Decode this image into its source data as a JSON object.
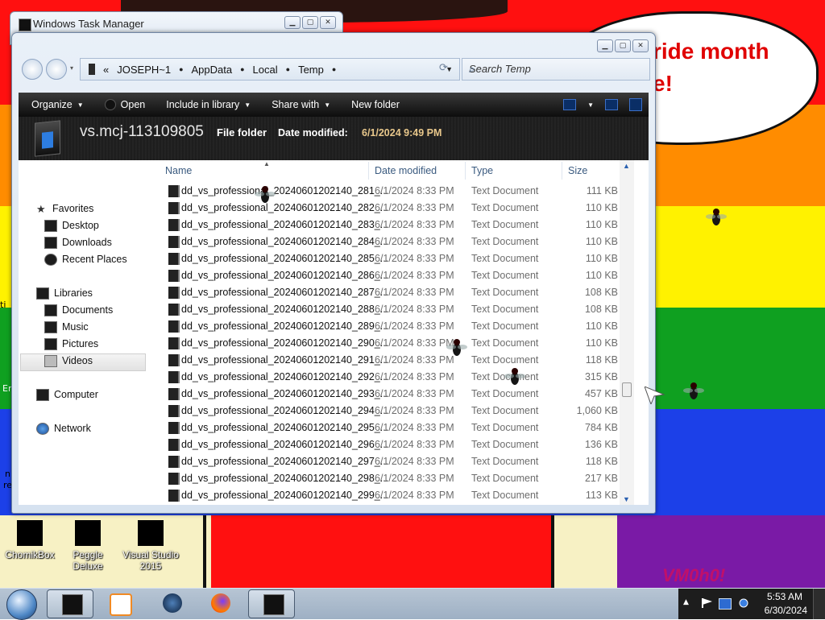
{
  "colors": {
    "red": "#ff1010",
    "orange": "#ff8c00",
    "yellow": "#fff200",
    "green": "#0fa020",
    "blue": "#1c40e8",
    "purple": "#7a1aa6",
    "toolbar_bg": "#1a1a1a",
    "accent_text": "#e8c78b"
  },
  "wallpaper": {
    "bubble_text": "ride month\ne!",
    "watermark": "VM0h0!",
    "edge_text_1": "ti",
    "edge_text_2": "Er",
    "edge_text_3": "n",
    "edge_text_4": "re"
  },
  "desktop_icons": [
    {
      "label": "ChomikBox"
    },
    {
      "label": "Peggle Deluxe"
    },
    {
      "label": "Visual Studio 2015"
    }
  ],
  "task_manager": {
    "title": "Windows Task Manager"
  },
  "explorer": {
    "address": {
      "overflow": "«",
      "crumbs": [
        "JOSEPH~1",
        "AppData",
        "Local",
        "Temp"
      ]
    },
    "search_placeholder": "Search Temp",
    "toolbar": {
      "organize": "Organize",
      "open": "Open",
      "include_in_library": "Include in library",
      "share_with": "Share with",
      "new_folder": "New folder"
    },
    "details": {
      "name": "vs.mcj-113109805",
      "type": "File folder",
      "modified_label": "Date modified:",
      "modified_value": "6/1/2024 9:49 PM"
    },
    "nav": {
      "favorites": "Favorites",
      "desktop": "Desktop",
      "downloads": "Downloads",
      "recent_places": "Recent Places",
      "libraries": "Libraries",
      "documents": "Documents",
      "music": "Music",
      "pictures": "Pictures",
      "videos": "Videos",
      "computer": "Computer",
      "network": "Network"
    },
    "columns": {
      "name": "Name",
      "date_modified": "Date modified",
      "type": "Type",
      "size": "Size"
    },
    "files": [
      {
        "name": "dd_vs_professional_20240601202140_281_...",
        "date": "6/1/2024 8:33 PM",
        "type": "Text Document",
        "size": "111 KB"
      },
      {
        "name": "dd_vs_professional_20240601202140_282_...",
        "date": "6/1/2024 8:33 PM",
        "type": "Text Document",
        "size": "110 KB"
      },
      {
        "name": "dd_vs_professional_20240601202140_283_...",
        "date": "6/1/2024 8:33 PM",
        "type": "Text Document",
        "size": "110 KB"
      },
      {
        "name": "dd_vs_professional_20240601202140_284_...",
        "date": "6/1/2024 8:33 PM",
        "type": "Text Document",
        "size": "110 KB"
      },
      {
        "name": "dd_vs_professional_20240601202140_285_...",
        "date": "6/1/2024 8:33 PM",
        "type": "Text Document",
        "size": "110 KB"
      },
      {
        "name": "dd_vs_professional_20240601202140_286_...",
        "date": "6/1/2024 8:33 PM",
        "type": "Text Document",
        "size": "110 KB"
      },
      {
        "name": "dd_vs_professional_20240601202140_287_...",
        "date": "6/1/2024 8:33 PM",
        "type": "Text Document",
        "size": "108 KB"
      },
      {
        "name": "dd_vs_professional_20240601202140_288_...",
        "date": "6/1/2024 8:33 PM",
        "type": "Text Document",
        "size": "108 KB"
      },
      {
        "name": "dd_vs_professional_20240601202140_289_...",
        "date": "6/1/2024 8:33 PM",
        "type": "Text Document",
        "size": "110 KB"
      },
      {
        "name": "dd_vs_professional_20240601202140_290_...",
        "date": "6/1/2024 8:33 PM",
        "type": "Text Document",
        "size": "110 KB"
      },
      {
        "name": "dd_vs_professional_20240601202140_291_...",
        "date": "6/1/2024 8:33 PM",
        "type": "Text Document",
        "size": "118 KB"
      },
      {
        "name": "dd_vs_professional_20240601202140_292_...",
        "date": "6/1/2024 8:33 PM",
        "type": "Text Document",
        "size": "315 KB"
      },
      {
        "name": "dd_vs_professional_20240601202140_293_...",
        "date": "6/1/2024 8:33 PM",
        "type": "Text Document",
        "size": "457 KB"
      },
      {
        "name": "dd_vs_professional_20240601202140_294_...",
        "date": "6/1/2024 8:33 PM",
        "type": "Text Document",
        "size": "1,060 KB"
      },
      {
        "name": "dd_vs_professional_20240601202140_295_...",
        "date": "6/1/2024 8:33 PM",
        "type": "Text Document",
        "size": "784 KB"
      },
      {
        "name": "dd_vs_professional_20240601202140_296_...",
        "date": "6/1/2024 8:33 PM",
        "type": "Text Document",
        "size": "136 KB"
      },
      {
        "name": "dd_vs_professional_20240601202140_297_...",
        "date": "6/1/2024 8:33 PM",
        "type": "Text Document",
        "size": "118 KB"
      },
      {
        "name": "dd_vs_professional_20240601202140_298_...",
        "date": "6/1/2024 8:33 PM",
        "type": "Text Document",
        "size": "217 KB"
      },
      {
        "name": "dd_vs_professional_20240601202140_299_...",
        "date": "6/1/2024 8:33 PM",
        "type": "Text Document",
        "size": "113 KB"
      }
    ]
  },
  "taskbar": {
    "start": "start-orb-icon",
    "clock_time": "5:53 AM",
    "clock_date": "6/30/2024"
  }
}
